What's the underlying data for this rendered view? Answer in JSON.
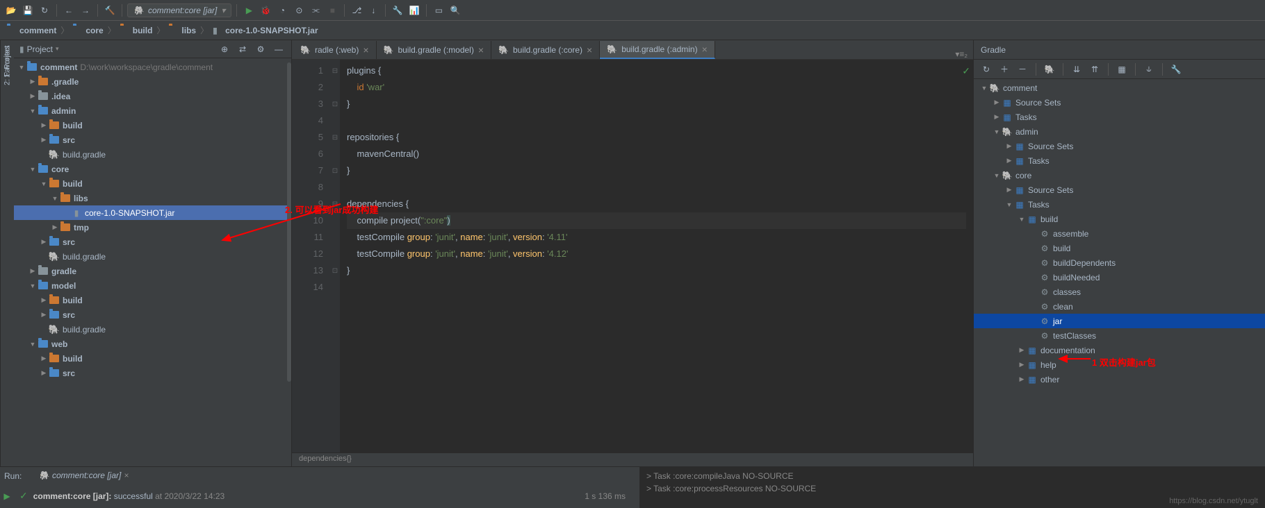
{
  "toolbar": {
    "run_config": "comment:core [jar]"
  },
  "breadcrumb": {
    "items": [
      "comment",
      "core",
      "build",
      "libs",
      "core-1.0-SNAPSHOT.jar"
    ]
  },
  "project_panel": {
    "title": "Project",
    "root": {
      "label": "comment",
      "path": "D:\\work\\workspace\\gradle\\comment"
    },
    "tree": [
      {
        "ind": 1,
        "arrow": "▶",
        "icon": "folder-orange",
        "label": ".gradle"
      },
      {
        "ind": 1,
        "arrow": "▶",
        "icon": "folder",
        "label": ".idea"
      },
      {
        "ind": 1,
        "arrow": "▼",
        "icon": "module",
        "label": "admin"
      },
      {
        "ind": 2,
        "arrow": "▶",
        "icon": "folder-orange",
        "label": "build"
      },
      {
        "ind": 2,
        "arrow": "▶",
        "icon": "folder-blue",
        "label": "src"
      },
      {
        "ind": 2,
        "arrow": "",
        "icon": "gradle",
        "label": "build.gradle",
        "normal": true
      },
      {
        "ind": 1,
        "arrow": "▼",
        "icon": "module",
        "label": "core"
      },
      {
        "ind": 2,
        "arrow": "▼",
        "icon": "folder-orange",
        "label": "build"
      },
      {
        "ind": 3,
        "arrow": "▼",
        "icon": "folder-orange",
        "label": "libs"
      },
      {
        "ind": 4,
        "arrow": "",
        "icon": "jar",
        "label": "core-1.0-SNAPSHOT.jar",
        "normal": true,
        "selected": true
      },
      {
        "ind": 3,
        "arrow": "▶",
        "icon": "folder-orange",
        "label": "tmp"
      },
      {
        "ind": 2,
        "arrow": "▶",
        "icon": "folder-blue",
        "label": "src"
      },
      {
        "ind": 2,
        "arrow": "",
        "icon": "gradle",
        "label": "build.gradle",
        "normal": true
      },
      {
        "ind": 1,
        "arrow": "▶",
        "icon": "folder",
        "label": "gradle"
      },
      {
        "ind": 1,
        "arrow": "▼",
        "icon": "module",
        "label": "model"
      },
      {
        "ind": 2,
        "arrow": "▶",
        "icon": "folder-orange",
        "label": "build"
      },
      {
        "ind": 2,
        "arrow": "▶",
        "icon": "folder-blue",
        "label": "src"
      },
      {
        "ind": 2,
        "arrow": "",
        "icon": "gradle",
        "label": "build.gradle",
        "normal": true
      },
      {
        "ind": 1,
        "arrow": "▼",
        "icon": "module",
        "label": "web"
      },
      {
        "ind": 2,
        "arrow": "▶",
        "icon": "folder-orange",
        "label": "build"
      },
      {
        "ind": 2,
        "arrow": "▶",
        "icon": "folder-blue",
        "label": "src"
      }
    ]
  },
  "editor": {
    "tabs": [
      {
        "label": "radle (:web)",
        "active": false
      },
      {
        "label": "build.gradle (:model)",
        "active": false
      },
      {
        "label": "build.gradle (:core)",
        "active": false
      },
      {
        "label": "build.gradle (:admin)",
        "active": true
      }
    ],
    "tab_tools": "▾≡₂",
    "lines": 14,
    "code": [
      {
        "n": 1,
        "html": "plugins <span class='md'>{</span>"
      },
      {
        "n": 2,
        "html": "    <span class='kw'>id</span> <span class='str'>'war'</span>"
      },
      {
        "n": 3,
        "html": "<span class='md'>}</span>"
      },
      {
        "n": 4,
        "html": ""
      },
      {
        "n": 5,
        "html": "repositories <span class='md'>{</span>"
      },
      {
        "n": 6,
        "html": "    mavenCentral()"
      },
      {
        "n": 7,
        "html": "<span class='md'>}</span>"
      },
      {
        "n": 8,
        "html": ""
      },
      {
        "n": 9,
        "html": "dependencies <span class='md'>{</span>"
      },
      {
        "n": 10,
        "hl": true,
        "html": "    compile project(<span class='str'>\":core\"</span><span class='paren-hl'>)</span>"
      },
      {
        "n": 11,
        "html": "    testCompile <span class='fn'>group</span>: <span class='str'>'junit'</span>, <span class='fn'>name</span>: <span class='str'>'junit'</span>, <span class='fn'>version</span>: <span class='str'>'4.11'</span>"
      },
      {
        "n": 12,
        "html": "    testCompile <span class='fn'>group</span>: <span class='str'>'junit'</span>, <span class='fn'>name</span>: <span class='str'>'junit'</span>, <span class='fn'>version</span>: <span class='str'>'4.12'</span>"
      },
      {
        "n": 13,
        "html": "<span class='md'>}</span>"
      },
      {
        "n": 14,
        "html": ""
      }
    ],
    "status_path": "dependencies{}"
  },
  "gradle_panel": {
    "title": "Gradle",
    "tree": [
      {
        "ind": 0,
        "arrow": "▼",
        "icon": "elephant",
        "label": "comment"
      },
      {
        "ind": 1,
        "arrow": "▶",
        "icon": "tasks",
        "label": "Source Sets"
      },
      {
        "ind": 1,
        "arrow": "▶",
        "icon": "tasks",
        "label": "Tasks"
      },
      {
        "ind": 1,
        "arrow": "▼",
        "icon": "elephant",
        "label": "admin"
      },
      {
        "ind": 2,
        "arrow": "▶",
        "icon": "tasks",
        "label": "Source Sets"
      },
      {
        "ind": 2,
        "arrow": "▶",
        "icon": "tasks",
        "label": "Tasks"
      },
      {
        "ind": 1,
        "arrow": "▼",
        "icon": "elephant",
        "label": "core"
      },
      {
        "ind": 2,
        "arrow": "▶",
        "icon": "tasks",
        "label": "Source Sets"
      },
      {
        "ind": 2,
        "arrow": "▼",
        "icon": "tasks",
        "label": "Tasks"
      },
      {
        "ind": 3,
        "arrow": "▼",
        "icon": "tasks-folder",
        "label": "build"
      },
      {
        "ind": 4,
        "arrow": "",
        "icon": "gear",
        "label": "assemble"
      },
      {
        "ind": 4,
        "arrow": "",
        "icon": "gear",
        "label": "build"
      },
      {
        "ind": 4,
        "arrow": "",
        "icon": "gear",
        "label": "buildDependents"
      },
      {
        "ind": 4,
        "arrow": "",
        "icon": "gear",
        "label": "buildNeeded"
      },
      {
        "ind": 4,
        "arrow": "",
        "icon": "gear",
        "label": "classes"
      },
      {
        "ind": 4,
        "arrow": "",
        "icon": "gear",
        "label": "clean"
      },
      {
        "ind": 4,
        "arrow": "",
        "icon": "gear",
        "label": "jar",
        "selected": true
      },
      {
        "ind": 4,
        "arrow": "",
        "icon": "gear",
        "label": "testClasses"
      },
      {
        "ind": 3,
        "arrow": "▶",
        "icon": "tasks-folder",
        "label": "documentation"
      },
      {
        "ind": 3,
        "arrow": "▶",
        "icon": "tasks-folder",
        "label": "help"
      },
      {
        "ind": 3,
        "arrow": "▶",
        "icon": "tasks-folder",
        "label": "other"
      }
    ]
  },
  "annotations": {
    "left": "2. 可以看到jar成功构建",
    "right": "1 双击构建jar包"
  },
  "run_panel": {
    "label": "Run:",
    "tab": "comment:core [jar]",
    "status_bold": "comment:core [jar]:",
    "status_text": " successful",
    "status_time": " at 2020/3/22 14:23",
    "duration": "1 s 136 ms",
    "task_lines": [
      "> Task :core:compileJava NO-SOURCE",
      "> Task :core:processResources NO-SOURCE"
    ]
  },
  "sidebar_labels": {
    "project": "1: Project",
    "favorites": "2: Favorites"
  },
  "watermark": "https://blog.csdn.net/ytuglt"
}
